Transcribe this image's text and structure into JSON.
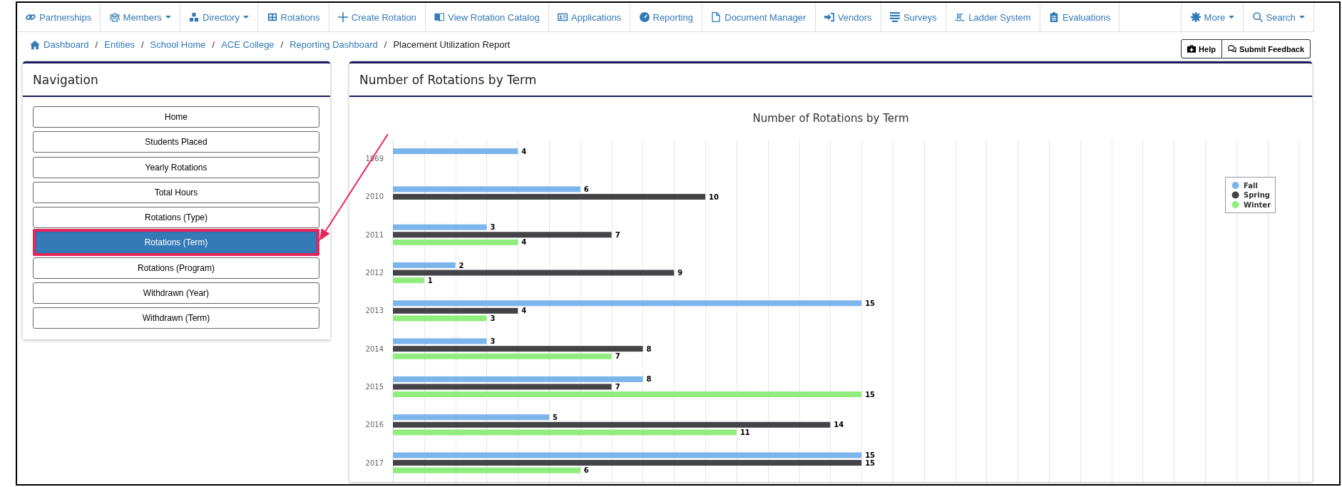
{
  "top_nav": {
    "items": [
      {
        "label": "Partnerships",
        "dropdown": false
      },
      {
        "label": "Members",
        "dropdown": true
      },
      {
        "label": "Directory",
        "dropdown": true
      },
      {
        "label": "Rotations",
        "dropdown": false
      },
      {
        "label": "Create Rotation",
        "dropdown": false
      },
      {
        "label": "View Rotation Catalog",
        "dropdown": false
      },
      {
        "label": "Applications",
        "dropdown": false
      },
      {
        "label": "Reporting",
        "dropdown": false
      },
      {
        "label": "Document Manager",
        "dropdown": false
      },
      {
        "label": "Vendors",
        "dropdown": false
      },
      {
        "label": "Surveys",
        "dropdown": false
      },
      {
        "label": "Ladder System",
        "dropdown": false
      },
      {
        "label": "Evaluations",
        "dropdown": false
      }
    ],
    "right_items": [
      {
        "label": "More",
        "dropdown": true
      },
      {
        "label": "Search",
        "dropdown": true
      }
    ]
  },
  "breadcrumb": [
    {
      "label": "Dashboard",
      "current": false,
      "separator": "/"
    },
    {
      "label": "Entities",
      "current": false,
      "separator": "/"
    },
    {
      "label": "School Home",
      "current": false,
      "separator": "/"
    },
    {
      "label": "ACE College",
      "current": false,
      "separator": "/"
    },
    {
      "label": "Reporting Dashboard",
      "current": false,
      "separator": "/"
    },
    {
      "label": "Placement Utilization Report",
      "current": true
    }
  ],
  "page_buttons": [
    {
      "label": "Help"
    },
    {
      "label": "Submit Feedback"
    }
  ],
  "navigation": {
    "title": "Navigation",
    "items": [
      {
        "label": "Home",
        "selected": false,
        "highlighted": false
      },
      {
        "label": "Students Placed",
        "selected": false,
        "highlighted": false
      },
      {
        "label": "Yearly Rotations",
        "selected": false,
        "highlighted": false
      },
      {
        "label": "Total Hours",
        "selected": false,
        "highlighted": false
      },
      {
        "label": "Rotations (Type)",
        "selected": false,
        "highlighted": false
      },
      {
        "label": "Rotations (Term)",
        "selected": true,
        "highlighted": true
      },
      {
        "label": "Rotations (Program)",
        "selected": false,
        "highlighted": false
      },
      {
        "label": "Withdrawn (Year)",
        "selected": false,
        "highlighted": false
      },
      {
        "label": "Withdrawn (Term)",
        "selected": false,
        "highlighted": false
      }
    ]
  },
  "chart_panel": {
    "title": "Number of Rotations by Term",
    "chart_data": {
      "type": "bar",
      "orientation": "horizontal",
      "title": "Number of Rotations by Term",
      "categories": [
        "1969",
        "2010",
        "2011",
        "2012",
        "2013",
        "2014",
        "2015",
        "2016",
        "2017"
      ],
      "series": [
        {
          "name": "Fall",
          "color": "#7cb5ec",
          "values": [
            4,
            6,
            3,
            2,
            15,
            3,
            8,
            5,
            15
          ]
        },
        {
          "name": "Spring",
          "color": "#434348",
          "values": [
            null,
            10,
            7,
            9,
            4,
            8,
            7,
            14,
            15
          ]
        },
        {
          "name": "Winter",
          "color": "#90ed7d",
          "values": [
            null,
            null,
            4,
            1,
            3,
            7,
            15,
            11,
            6
          ]
        }
      ],
      "data_labels": true,
      "legend": "right"
    }
  },
  "annotation": {
    "kind": "arrow"
  }
}
